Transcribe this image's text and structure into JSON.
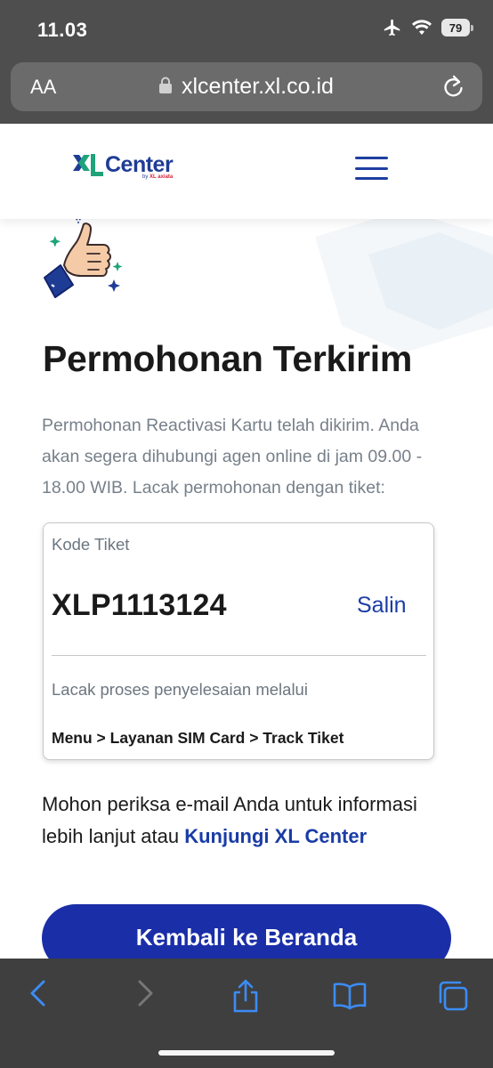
{
  "status_bar": {
    "time": "11.03",
    "battery": "79"
  },
  "browser": {
    "text_size_label": "AA",
    "url": "xlcenter.xl.co.id"
  },
  "site": {
    "logo_text": "Center",
    "logo_sub_prefix": "by",
    "logo_sub_brand": "XL axiata",
    "brand_color": "#1f3c95"
  },
  "main": {
    "title": "Permohonan Terkirim",
    "description": "Permohonan Reactivasi Kartu telah dikirim. Anda akan segera dihubungi agen online di jam 09.00 - 18.00 WIB. Lacak permohonan dengan tiket:",
    "ticket": {
      "label": "Kode Tiket",
      "code": "XLP1113124",
      "copy_label": "Salin",
      "track_label": "Lacak proses penyelesaian melalui",
      "track_path": "Menu > Layanan SIM Card > Track Tiket"
    },
    "email_note_text": "Mohon periksa e-mail Anda untuk informasi lebih lanjut atau ",
    "email_note_link": "Kunjungi XL Center",
    "cta_label": "Kembali ke Beranda",
    "cta_color": "#1a2ea8"
  },
  "toolbar_icons": [
    "back-icon",
    "forward-icon",
    "share-icon",
    "bookmarks-icon",
    "tabs-icon"
  ]
}
